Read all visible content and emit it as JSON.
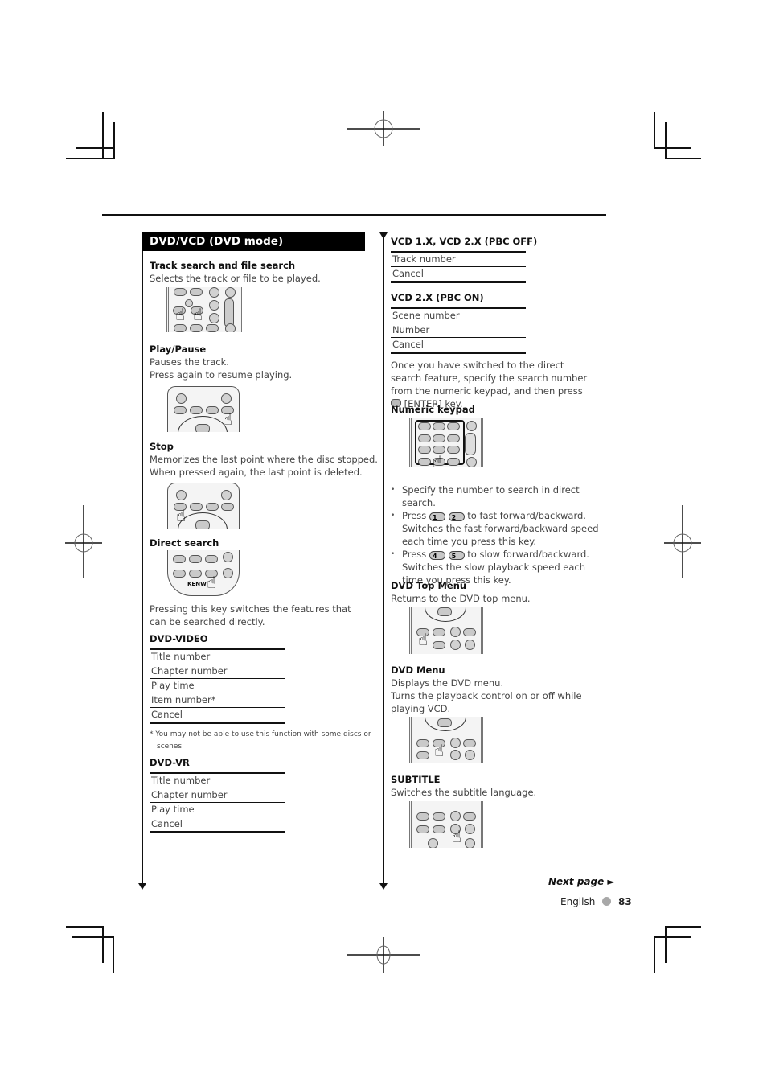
{
  "page": {
    "section_title": "DVD/VCD (DVD mode)",
    "footer": {
      "next_page": "Next page ►",
      "language": "English",
      "page_number": "83"
    }
  },
  "left": {
    "track_search": {
      "title": "Track search and file search",
      "desc": "Selects the track or file to be played."
    },
    "play_pause": {
      "title": "Play/Pause",
      "desc1": "Pauses the track.",
      "desc2": "Press again to resume playing."
    },
    "stop": {
      "title": "Stop",
      "desc1": "Memorizes the last point where the disc stopped.",
      "desc2": "When pressed again, the last point is deleted."
    },
    "direct_search": {
      "title": "Direct search",
      "desc": "Pressing this key switches the features that can be searched directly.",
      "dvd_video": {
        "title": "DVD-VIDEO",
        "items": [
          "Title number",
          "Chapter number",
          "Play time",
          "Item number*",
          "Cancel"
        ]
      },
      "footnote": "* You may not be able to use this function with some discs or scenes.",
      "dvd_vr": {
        "title": "DVD-VR",
        "items": [
          "Title number",
          "Chapter number",
          "Play time",
          "Cancel"
        ]
      }
    }
  },
  "right": {
    "vcd_pbc_off": {
      "title": "VCD 1.X, VCD 2.X (PBC OFF)",
      "items": [
        "Track number",
        "Cancel"
      ]
    },
    "vcd_pbc_on": {
      "title": "VCD 2.X (PBC ON)",
      "items": [
        "Scene number",
        "Number",
        "Cancel"
      ]
    },
    "direct_note": {
      "part1": "Once you have switched to the direct search feature, specify the search number from the numeric keypad, and then press",
      "part2": "[ENTER] key."
    },
    "numeric_keypad": {
      "title": "Numeric keypad",
      "bullets": {
        "b1": "Specify the number to search in direct search.",
        "b2_press": "Press",
        "b2_key1": "1",
        "b2_key2": "2",
        "b2_rest": "to fast forward/backward. Switches the fast forward/backward speed each time you press this key.",
        "b3_press": "Press",
        "b3_key1": "4",
        "b3_key2": "5",
        "b3_rest": "to slow forward/backward. Switches the slow playback speed each time you press this key."
      }
    },
    "dvd_top_menu": {
      "title": "DVD Top Menu",
      "desc": "Returns to the DVD top menu."
    },
    "dvd_menu": {
      "title": "DVD Menu",
      "desc1": "Displays the DVD menu.",
      "desc2": "Turns the playback control on or off while playing VCD."
    },
    "subtitle": {
      "title": "SUBTITLE",
      "desc": "Switches the subtitle language."
    }
  }
}
